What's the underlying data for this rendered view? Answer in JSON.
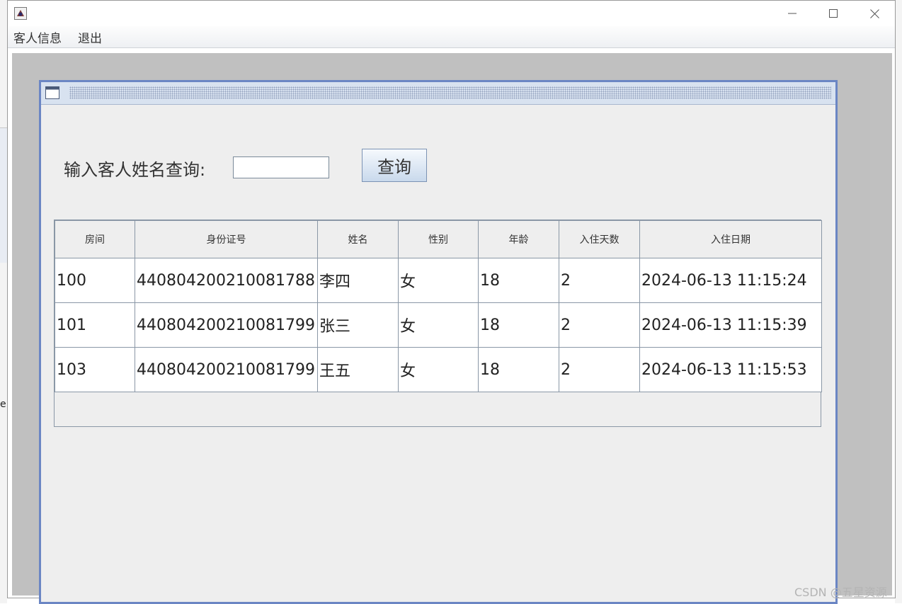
{
  "menu": {
    "guest_info": "客人信息",
    "exit": "退出"
  },
  "query": {
    "label": "输入客人姓名查询:",
    "input_value": "",
    "button": "查询"
  },
  "table": {
    "columns": [
      "房间",
      "身份证号",
      "姓名",
      "性别",
      "年龄",
      "入住天数",
      "入住日期"
    ],
    "rows": [
      [
        "100",
        "440804200210081788",
        "李四",
        "女",
        "18",
        "2",
        "2024-06-13 11:15:24"
      ],
      [
        "101",
        "440804200210081799",
        "张三",
        "女",
        "18",
        "2",
        "2024-06-13 11:15:39"
      ],
      [
        "103",
        "440804200210081799",
        "王五",
        "女",
        "18",
        "2",
        "2024-06-13 11:15:53"
      ]
    ]
  },
  "peek": {
    "left_char": "e"
  },
  "watermark": "CSDN @五星资源",
  "colors": {
    "desktop": "#c0c0c0",
    "frame_border": "#6b86c4",
    "panel": "#eeeeee"
  }
}
